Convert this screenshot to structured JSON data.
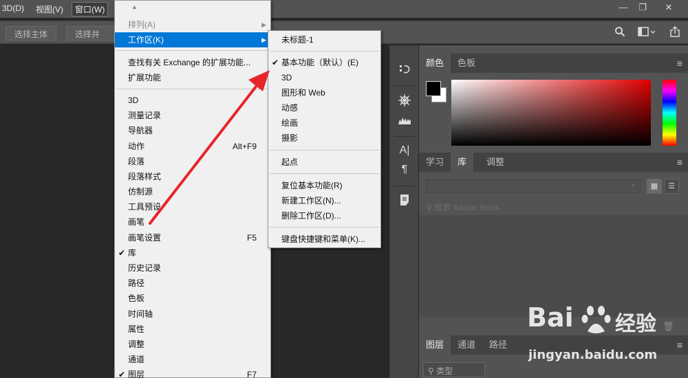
{
  "menubar": {
    "items": [
      {
        "label": "3D(D)"
      },
      {
        "label": "视图(V)"
      },
      {
        "label": "窗口(W)"
      }
    ],
    "window_controls": [
      "—",
      "❐",
      "✕"
    ]
  },
  "options_bar": {
    "select_subject": "选择主体",
    "select_mask": "选择并遮住",
    "icons": [
      "search-icon",
      "workspace-icon",
      "share-icon"
    ]
  },
  "window_menu": {
    "items": [
      {
        "label": "排列(A)",
        "shortcut": "",
        "submenu": true,
        "disabled": true
      },
      {
        "label": "工作区(K)",
        "shortcut": "",
        "submenu": true,
        "highlighted": true
      },
      {
        "label": "查找有关 Exchange 的扩展功能...",
        "shortcut": ""
      },
      {
        "label": "扩展功能",
        "shortcut": "",
        "submenu": true
      },
      {
        "label": "3D",
        "shortcut": ""
      },
      {
        "label": "测量记录",
        "shortcut": ""
      },
      {
        "label": "导航器",
        "shortcut": ""
      },
      {
        "label": "动作",
        "shortcut": "Alt+F9"
      },
      {
        "label": "段落",
        "shortcut": ""
      },
      {
        "label": "段落样式",
        "shortcut": ""
      },
      {
        "label": "仿制源",
        "shortcut": ""
      },
      {
        "label": "工具预设",
        "shortcut": ""
      },
      {
        "label": "画笔",
        "shortcut": ""
      },
      {
        "label": "画笔设置",
        "shortcut": "F5"
      },
      {
        "label": "库",
        "shortcut": "",
        "checked": true
      },
      {
        "label": "历史记录",
        "shortcut": ""
      },
      {
        "label": "路径",
        "shortcut": ""
      },
      {
        "label": "色板",
        "shortcut": ""
      },
      {
        "label": "时间轴",
        "shortcut": ""
      },
      {
        "label": "属性",
        "shortcut": ""
      },
      {
        "label": "调整",
        "shortcut": ""
      },
      {
        "label": "通道",
        "shortcut": ""
      },
      {
        "label": "图层",
        "shortcut": "F7",
        "checked": true
      }
    ]
  },
  "workspace_submenu": {
    "items": [
      {
        "label": "未标题-1"
      },
      {
        "label": "基本功能（默认）(E)",
        "checked": true
      },
      {
        "label": "3D"
      },
      {
        "label": "图形和 Web"
      },
      {
        "label": "动感"
      },
      {
        "label": "绘画"
      },
      {
        "label": "摄影"
      },
      {
        "label": "起点"
      },
      {
        "label": "复位基本功能(R)"
      },
      {
        "label": "新建工作区(N)..."
      },
      {
        "label": "删除工作区(D)..."
      },
      {
        "label": "键盘快捷键和菜单(K)..."
      }
    ]
  },
  "panels": {
    "color_tabs": [
      "颜色",
      "色板"
    ],
    "library_tabs": [
      "学习",
      "库",
      "调整"
    ],
    "stock_placeholder": "搜索 Adobe Stock",
    "layers_tabs": [
      "图层",
      "通道",
      "路径"
    ],
    "layer_filter": "类型"
  },
  "toolstrip": {
    "icons": [
      "history-icon",
      "adjust-icon",
      "histogram-icon",
      "character-icon",
      "paragraph-icon",
      "notes-icon"
    ]
  },
  "watermark": {
    "logo": "Bai",
    "logo_suffix": "百度",
    "brand_cn": "经验",
    "url": "jingyan.baidu.com"
  },
  "colors": {
    "menu_highlight": "#0078d7",
    "arrow": "#e8242b",
    "panel_bg": "#535353"
  }
}
